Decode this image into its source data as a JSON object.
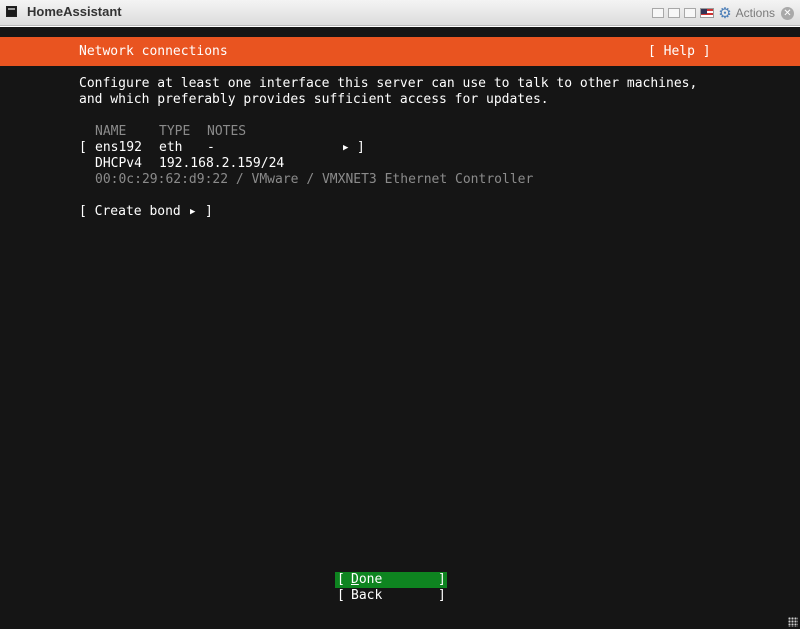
{
  "window": {
    "title": "HomeAssistant",
    "actions_label": "Actions"
  },
  "header": {
    "title": "Network connections",
    "help_label": "[ Help ]"
  },
  "intro": {
    "line1": "Configure at least one interface this server can use to talk to other machines,",
    "line2": "and which preferably provides sufficient access for updates."
  },
  "table": {
    "columns": [
      "NAME",
      "TYPE",
      "NOTES"
    ],
    "interface": {
      "open_bracket": "[",
      "name": "ens192",
      "type": "eth",
      "notes": "-",
      "close_bracket": "]",
      "address_method": "DHCPv4",
      "address": "192.168.2.159/24",
      "hw_info": "00:0c:29:62:d9:22 / VMware / VMXNET3 Ethernet Controller"
    }
  },
  "create_bond": {
    "label_open": "[ Create bond",
    "label_close": "]"
  },
  "buttons": {
    "open": "[",
    "close": "]",
    "done_hotkey": "D",
    "done_rest": "one",
    "back": "Back"
  },
  "colors": {
    "accent_orange": "#e95420",
    "done_green": "#0e8420",
    "terminal_bg": "#151515",
    "dim_text": "#8b8b8b"
  },
  "icons": {
    "app": "terminal-icon",
    "settings": "gear-icon",
    "locale": "us-flag-icon",
    "close": "close-icon",
    "submenu": "right-triangle-icon"
  }
}
